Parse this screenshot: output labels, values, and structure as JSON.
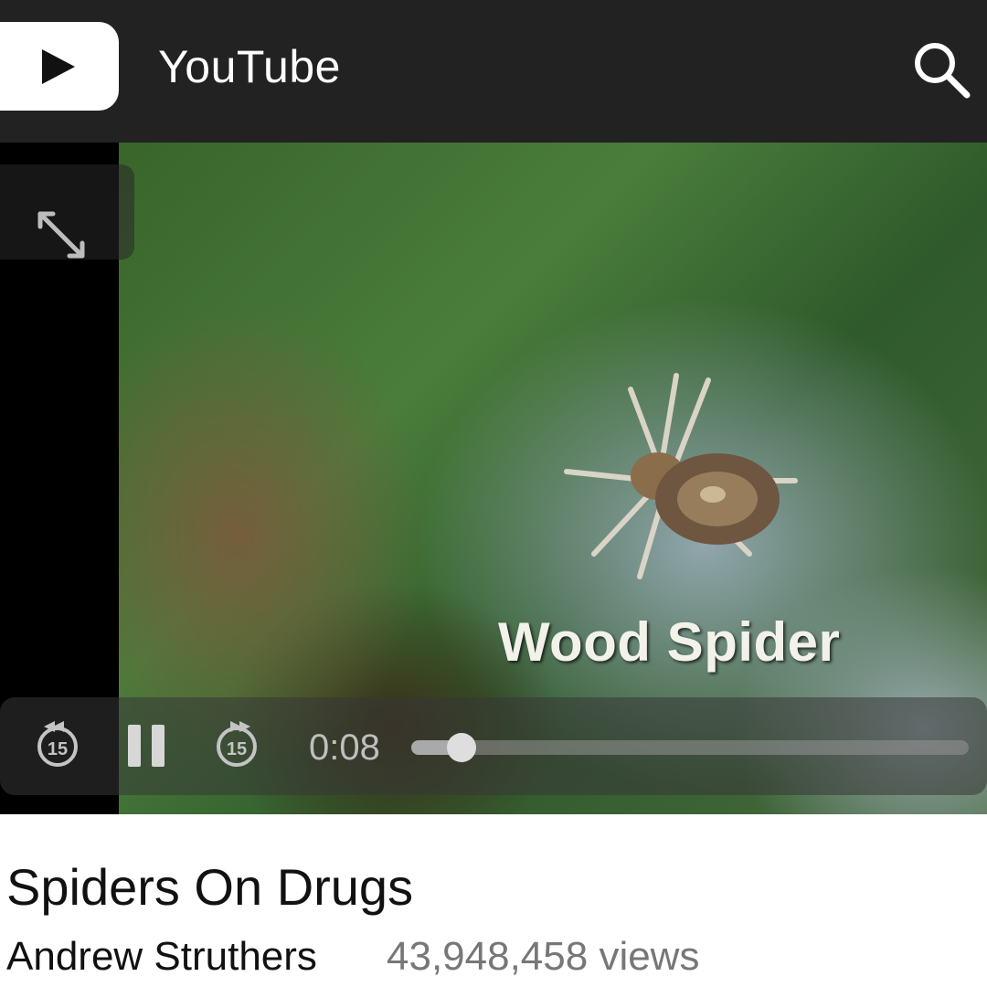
{
  "header": {
    "app_title": "YouTube",
    "logo_icon": "play-logo-icon",
    "search_icon": "search-icon",
    "background": "#222222"
  },
  "player": {
    "overlay_caption": "Wood Spider",
    "fullscreen_icon": "expand-arrows-icon",
    "controls": {
      "rewind_label": "15",
      "forward_label": "15",
      "pause_icon": "pause-icon",
      "current_time": "0:08",
      "progress_fraction": 0.09
    }
  },
  "video": {
    "title": "Spiders On Drugs",
    "channel": "Andrew Struthers",
    "views": "43,948,458 views"
  }
}
